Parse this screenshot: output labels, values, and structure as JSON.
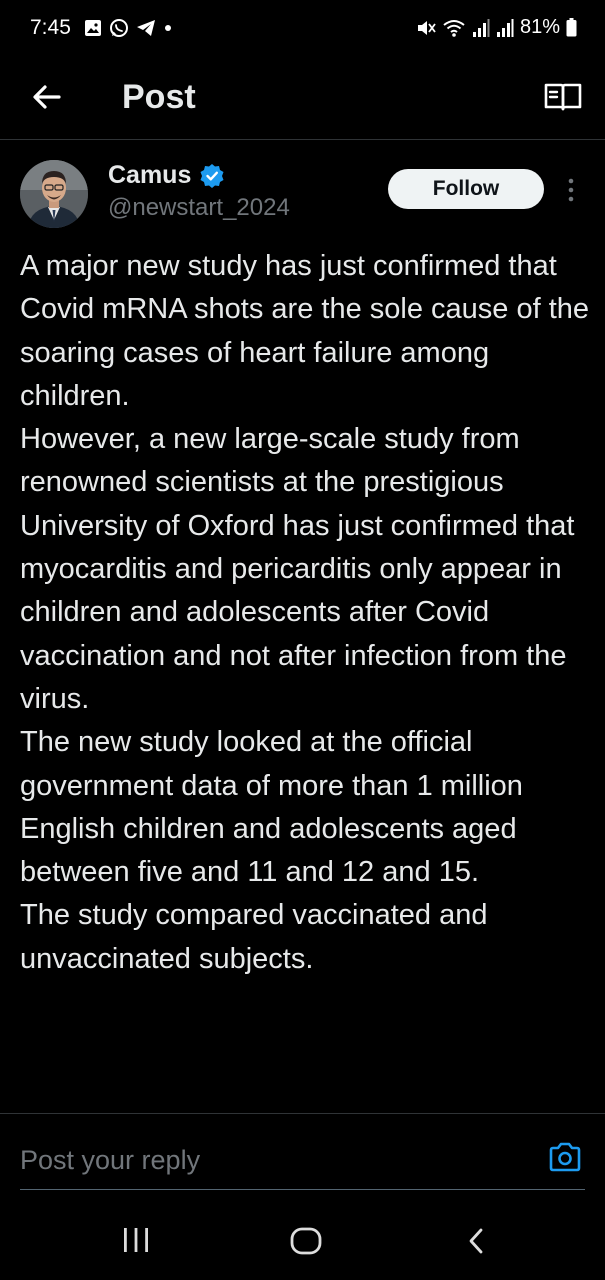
{
  "status_bar": {
    "time": "7:45",
    "left_icons": [
      "gallery-icon",
      "whatsapp-icon",
      "telegram-icon",
      "dot-icon"
    ],
    "right_icons": [
      "mute-icon",
      "wifi-icon",
      "signal-icon",
      "signal-icon",
      "battery-icon"
    ],
    "battery": "81%"
  },
  "header": {
    "title": "Post"
  },
  "post": {
    "author_name": "Camus",
    "author_handle": "@newstart_2024",
    "follow_label": "Follow",
    "verified": true,
    "paragraphs": [
      "A major new study has just confirmed that Covid mRNA shots are the sole cause of the soaring cases of heart failure among children.",
      "However, a new large-scale study from renowned scientists at the prestigious University of Oxford has just confirmed that myocarditis and pericarditis only appear in children and adolescents after Covid vaccination and not after infection from the virus.",
      "The new study looked at the official government data of more than 1 million English children and adolescents aged between five and 11 and 12 and 15.",
      "The study compared vaccinated and unvaccinated subjects."
    ]
  },
  "reply": {
    "placeholder": "Post your reply"
  },
  "colors": {
    "background": "#000000",
    "text": "#e7e9ea",
    "secondary_text": "#71767b",
    "accent": "#1d9bf0",
    "follow_bg": "#eff3f4"
  }
}
